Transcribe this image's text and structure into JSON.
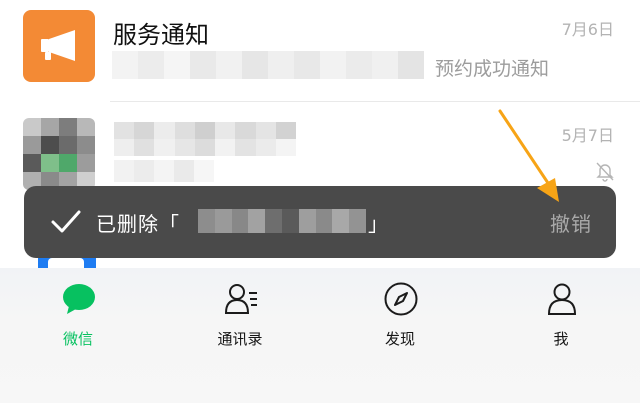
{
  "chats": [
    {
      "title": "服务通知",
      "date": "7月6日",
      "preview": "预约成功通知",
      "avatar_icon": "megaphone-icon",
      "avatar_color": "#f38a35"
    },
    {
      "date": "5月7日",
      "muted_icon": "bell-off-icon"
    }
  ],
  "toast": {
    "deleted_prefix": "已删除「",
    "deleted_suffix": "」",
    "undo_label": "撤销",
    "icon": "checkmark-icon"
  },
  "annotation": {
    "arrow_color": "#f7a416"
  },
  "tabbar": {
    "active_color": "#07c160",
    "tabs": [
      {
        "label": "微信",
        "icon": "chat-bubble-icon"
      },
      {
        "label": "通讯录",
        "icon": "contacts-icon"
      },
      {
        "label": "发现",
        "icon": "compass-icon"
      },
      {
        "label": "我",
        "icon": "person-icon"
      }
    ]
  }
}
